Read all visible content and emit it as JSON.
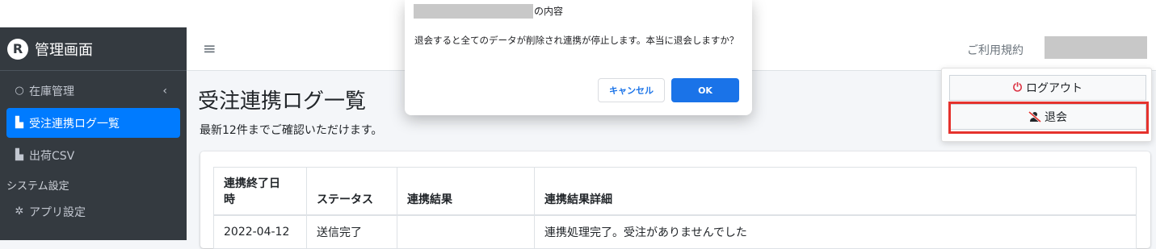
{
  "colors": {
    "sidebar_bg": "#343a40",
    "active_nav": "#007bff",
    "dialog_ok": "#1a73e8",
    "highlight_border": "#e5322d",
    "logout_icon": "#dc3545"
  },
  "sidebar": {
    "brand_logo": "R",
    "brand_name": "管理画面",
    "items": [
      {
        "label": "在庫管理",
        "icon": "circle-outline-icon",
        "glyph": "○",
        "has_chevron": true,
        "chevron": "‹"
      },
      {
        "label": "受注連携ログ一覧",
        "icon": "document-icon",
        "glyph": "▙",
        "active": true
      },
      {
        "label": "出荷CSV",
        "icon": "csv-file-icon",
        "glyph": "▙"
      },
      {
        "label": "システム設定",
        "header": true
      },
      {
        "label": "アプリ設定",
        "icon": "gear-icon",
        "glyph": "✲"
      }
    ]
  },
  "navbar": {
    "menu_icon": "≡",
    "terms_label": "ご利用規約"
  },
  "main": {
    "title": "受注連携ログ一覧",
    "subtitle": "最新12件までご確認いただけます。",
    "table": {
      "headers": [
        "連携終了日\n時",
        "ステータス",
        "連携結果",
        "連携結果詳細"
      ],
      "partial_row": [
        "2022-04-12",
        "送信完了",
        "",
        "連携処理完了。受注がありませんでした"
      ]
    }
  },
  "user_menu": {
    "logout_label": "ログアウト",
    "logout_icon": "⏻",
    "withdraw_label": "退会",
    "withdraw_icon": "✕"
  },
  "dialog": {
    "title_suffix": "の内容",
    "message": "退会すると全てのデータが削除され連携が停止します。本当に退会しますか？",
    "cancel_label": "キャンセル",
    "ok_label": "OK"
  }
}
